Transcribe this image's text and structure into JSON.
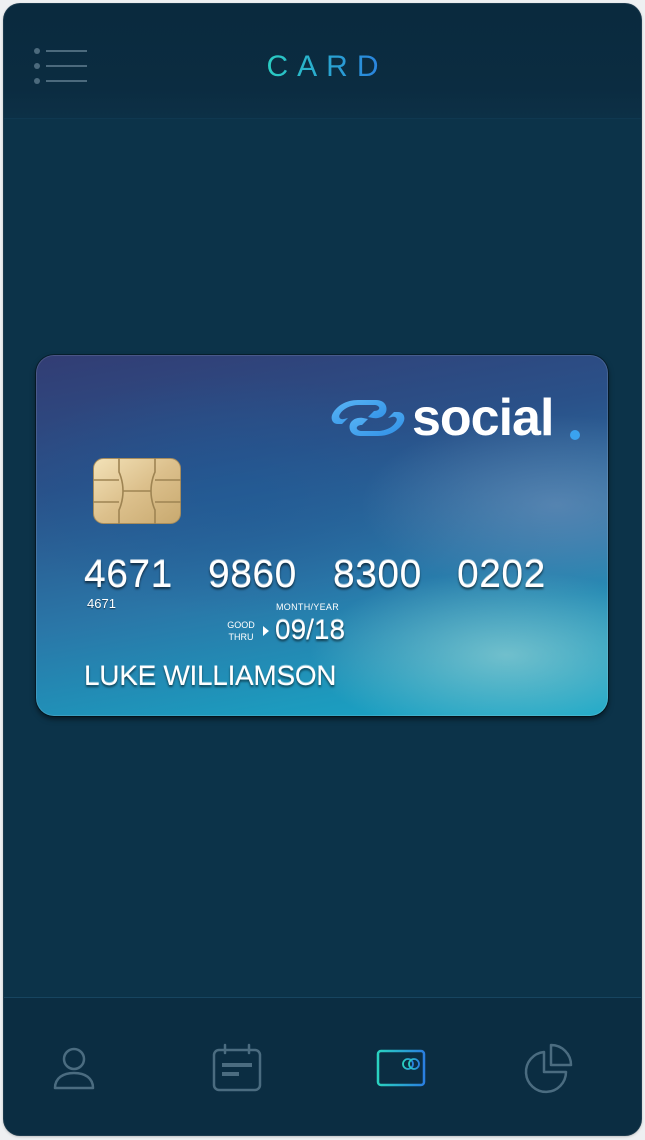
{
  "header": {
    "title": "CARD",
    "menu_icon": "list-menu-icon"
  },
  "card": {
    "brand": "social",
    "number_groups": [
      "4671",
      "9860",
      "8300",
      "0202"
    ],
    "number_small": "4671",
    "good_thru_line1": "GOOD",
    "good_thru_line2": "THRU",
    "month_year_label": "MONTH/YEAR",
    "expiry": "09/18",
    "holder_name": "LUKE WILLIAMSON",
    "chip_icon": "emv-chip-icon",
    "logo_icon": "social-chain-link-icon"
  },
  "bottom_nav": {
    "items": [
      {
        "icon": "profile-icon",
        "active": false
      },
      {
        "icon": "calendar-icon",
        "active": false
      },
      {
        "icon": "credit-card-icon",
        "active": true
      },
      {
        "icon": "pie-chart-icon",
        "active": false
      }
    ]
  },
  "colors": {
    "background": "#0c3349",
    "header": "#0a2a3e",
    "accent_teal": "#2ad2c0",
    "accent_blue": "#2a7fe0",
    "inactive_icon": "#4b6c80",
    "logo_blue": "#3aa3ef"
  }
}
